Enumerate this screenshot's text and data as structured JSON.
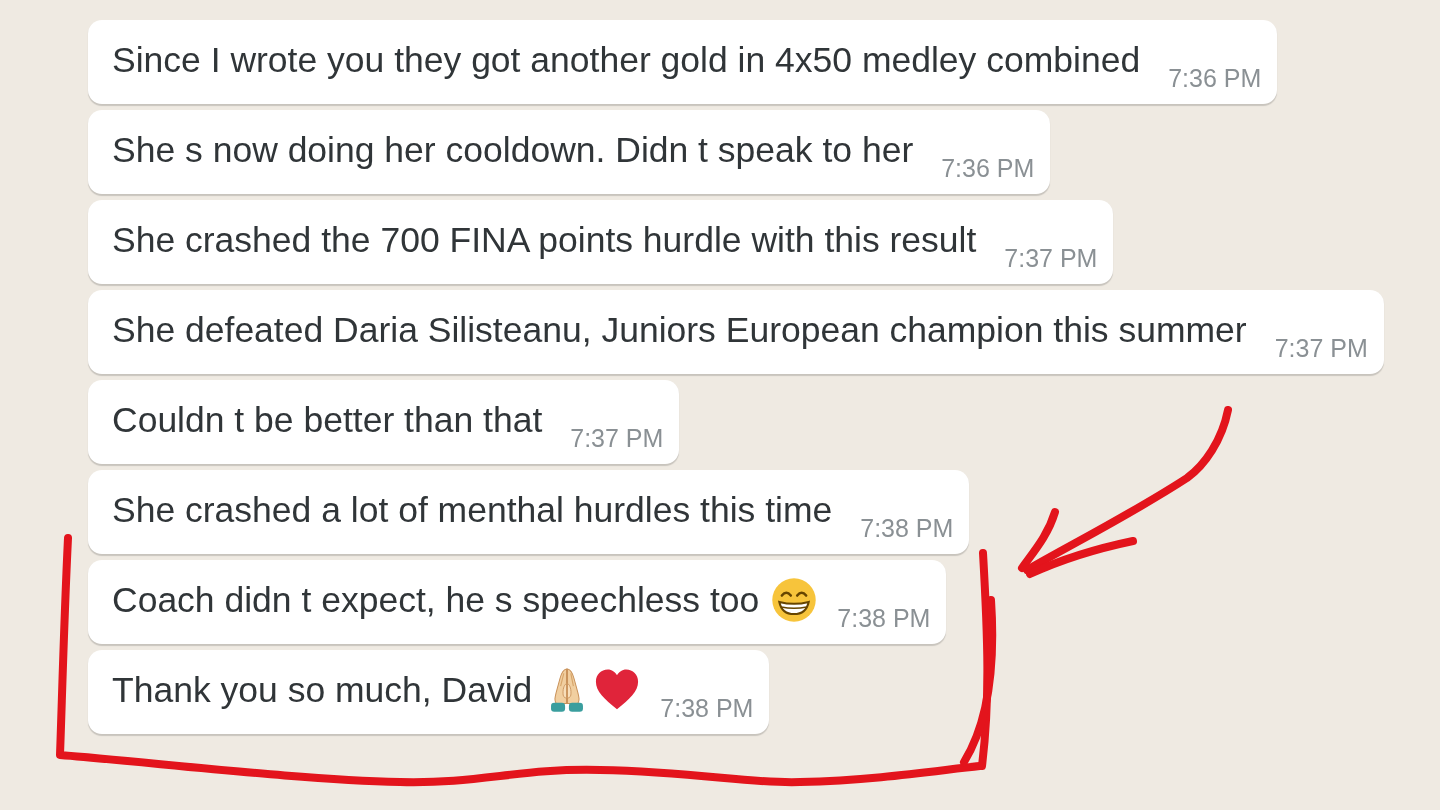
{
  "messages": [
    {
      "text": "Since I wrote you they got another gold in 4x50 medley combined",
      "time": "7:36 PM"
    },
    {
      "text": "She s now doing her cooldown. Didn t speak to her",
      "time": "7:36 PM"
    },
    {
      "text": "She crashed the 700 FINA points hurdle with this result",
      "time": "7:37 PM"
    },
    {
      "text": "She defeated Daria Silisteanu, Juniors European champion this summer",
      "time": "7:37 PM"
    },
    {
      "text": "Couldn t be better than that",
      "time": "7:37 PM"
    },
    {
      "text": "She crashed a lot of menthal hurdles this time",
      "time": "7:38 PM"
    },
    {
      "text": "Coach didn t expect, he s speechless too",
      "emojis": [
        {
          "kind": "beaming_face"
        }
      ],
      "time": "7:38 PM"
    },
    {
      "text": "Thank you so much, David",
      "emojis": [
        {
          "kind": "folded_hands"
        },
        {
          "kind": "red_heart"
        }
      ],
      "time": "7:38 PM"
    }
  ]
}
